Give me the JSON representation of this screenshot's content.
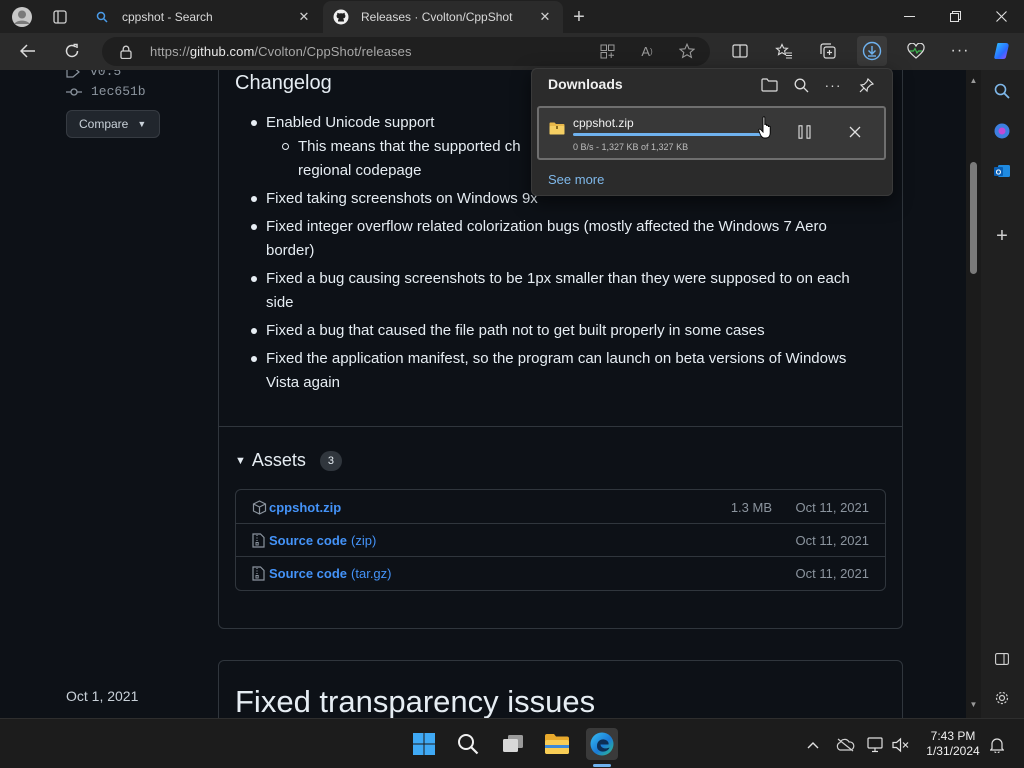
{
  "tabs": [
    {
      "title": "cppshot - Search",
      "active": false
    },
    {
      "title": "Releases · Cvolton/CppShot",
      "active": true
    }
  ],
  "address": {
    "scheme": "https://",
    "host": "github.com",
    "path": "/Cvolton/CppShot/releases"
  },
  "release_sidebar": {
    "tag": "v0.5",
    "commit": "1ec651b",
    "compare_label": "Compare"
  },
  "changelog": {
    "heading": "Changelog",
    "items": [
      {
        "lines": [
          "Enabled Unicode support"
        ],
        "sub": [
          {
            "lines": [
              "This means that the supported ch",
              "regional codepage"
            ]
          }
        ]
      },
      {
        "lines": [
          "Fixed taking screenshots on Windows 9x"
        ]
      },
      {
        "lines": [
          "Fixed integer overflow related colorization bugs (mostly affected the Windows 7 Aero",
          "border)"
        ]
      },
      {
        "lines": [
          "Fixed a bug causing screenshots to be 1px smaller than they were supposed to on each",
          "side"
        ]
      },
      {
        "lines": [
          "Fixed a bug that caused the file path not to get built properly in some cases"
        ]
      },
      {
        "lines": [
          "Fixed the application manifest, so the program can launch on beta versions of Windows",
          "Vista again"
        ]
      }
    ]
  },
  "assets": {
    "heading": "Assets",
    "count": "3",
    "rows": [
      {
        "icon": "package-icon",
        "name": "cppshot.zip",
        "suffix": "",
        "size": "1.3 MB",
        "date": "Oct 11, 2021"
      },
      {
        "icon": "file-zip-icon",
        "name": "Source code",
        "suffix": "(zip)",
        "size": "",
        "date": "Oct 11, 2021"
      },
      {
        "icon": "file-zip-icon",
        "name": "Source code",
        "suffix": "(tar.gz)",
        "size": "",
        "date": "Oct 11, 2021"
      }
    ]
  },
  "next_release": {
    "date": "Oct 1, 2021",
    "title": "Fixed transparency issues"
  },
  "downloads": {
    "title": "Downloads",
    "item": {
      "filename": "cppshot.zip",
      "status": "0 B/s - 1,327 KB of 1,327 KB",
      "progress": 1.0
    },
    "see_more": "See more"
  },
  "clock": {
    "time": "7:43 PM",
    "date": "1/31/2024"
  },
  "colors": {
    "link": "#4493f8",
    "progress": "#6fb2ef",
    "page_bg": "#0d1117"
  }
}
